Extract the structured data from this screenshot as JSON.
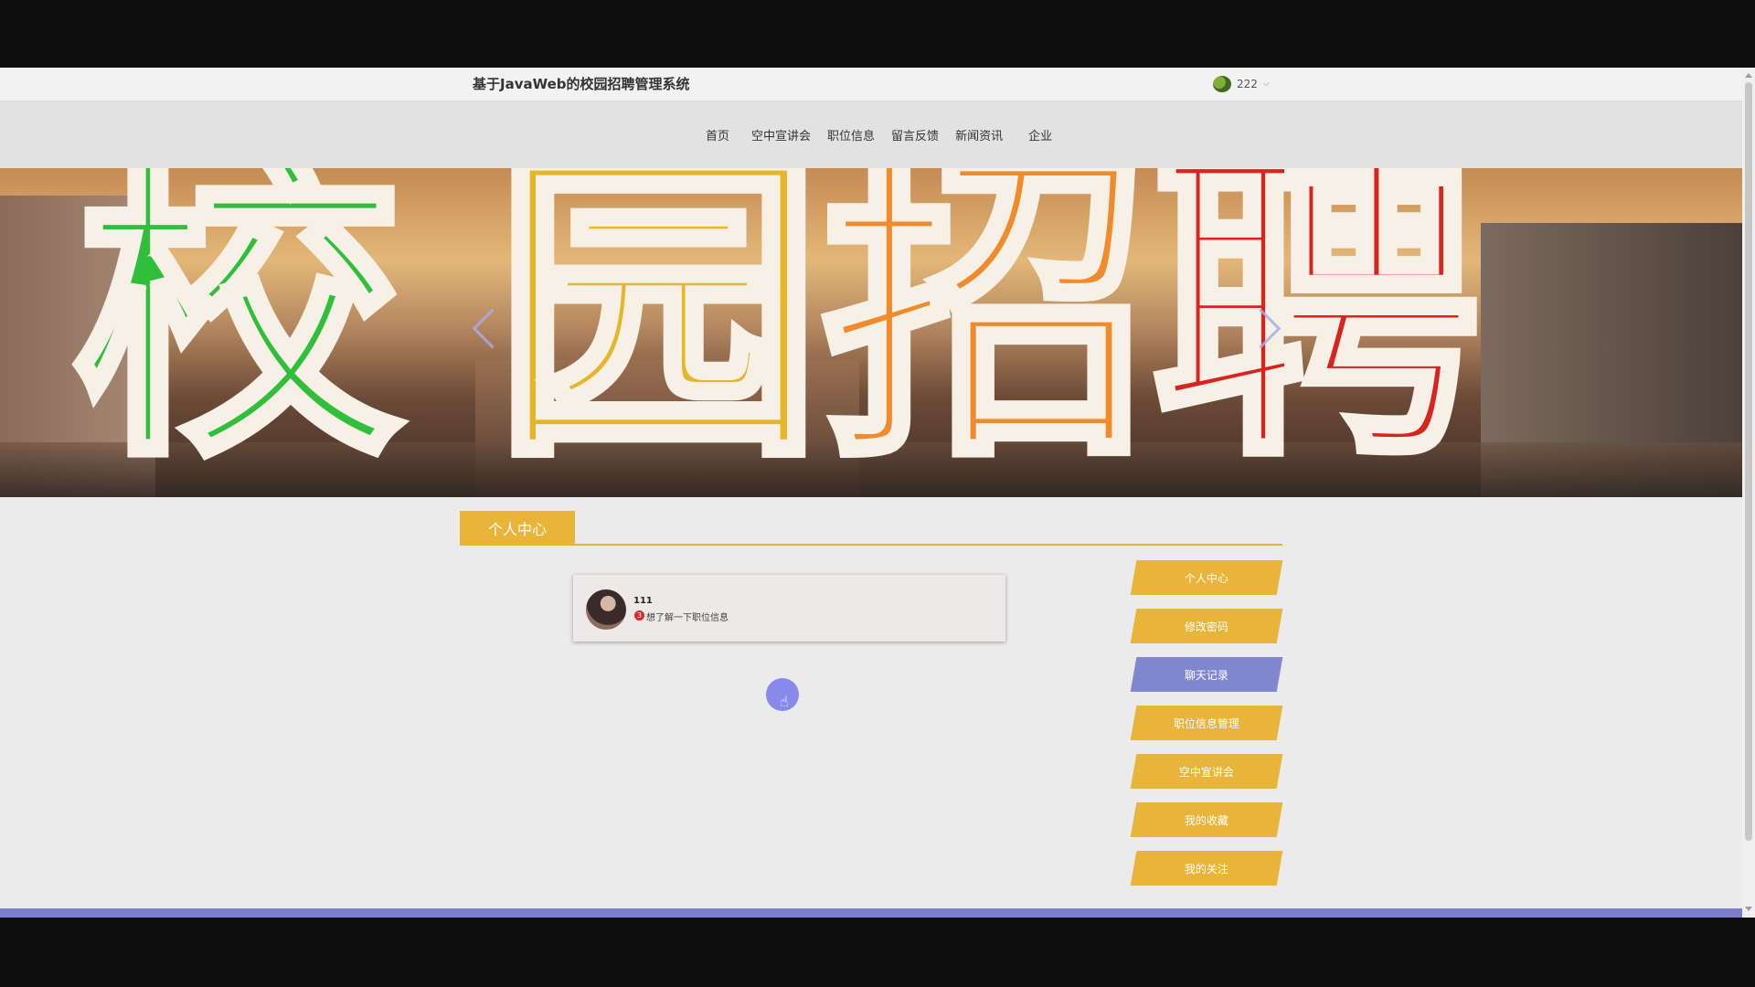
{
  "header": {
    "site_title": "基于JavaWeb的校园招聘管理系统",
    "user_name": "222",
    "user_caret": "⌵"
  },
  "nav": {
    "items": [
      "首页",
      "空中宣讲会",
      "职位信息",
      "留言反馈",
      "新闻资讯",
      "企业"
    ]
  },
  "banner": {
    "glyphs": [
      "校",
      "园",
      "招",
      "聘"
    ]
  },
  "section": {
    "title": "个人中心"
  },
  "chat": {
    "name": "111",
    "badge": "3",
    "message": "想了解一下职位信息"
  },
  "side_menu": {
    "items": [
      "个人中心",
      "修改密码",
      "聊天记录",
      "职位信息管理",
      "空中宣讲会",
      "我的收藏",
      "我的关注"
    ],
    "active_index": 2
  },
  "colors": {
    "accent": "#e9b43a",
    "active": "#8187cf",
    "footer": "#7b7fcb"
  }
}
